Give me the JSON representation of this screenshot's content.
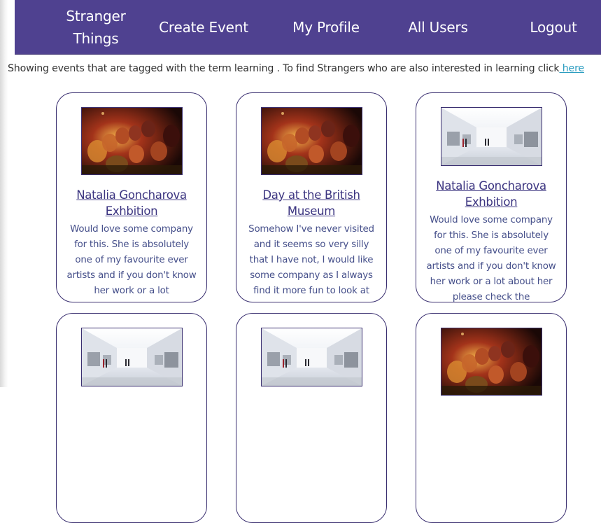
{
  "nav": {
    "brand": "Stranger Things",
    "items": [
      {
        "label": "Create Event"
      },
      {
        "label": "My Profile"
      },
      {
        "label": "All Users"
      },
      {
        "label": "Logout"
      }
    ]
  },
  "info": {
    "text": "Showing events that are tagged with the term learning . To find Strangers who are also interested in learning click",
    "link_label": " here"
  },
  "events": [
    {
      "title": "Natalia Goncharova Exhbition",
      "description": "Would love some company for this. She is absolutely one of my favourite ever artists and if you don't know her work or a lot",
      "image": "audience-photo"
    },
    {
      "title": "Day at the British Museum",
      "description": "Somehow I've never visited and it seems so very silly that I have not, I would like some company as I always find it more fun to look at",
      "image": "audience-photo"
    },
    {
      "title": "Natalia Goncharova Exhbition",
      "description": "Would love some company for this. She is absolutely one of my favourite ever artists and if you don't know her work or a lot about her please check the",
      "image": "gallery-photo"
    },
    {
      "title": "",
      "description": "",
      "image": "gallery-photo"
    },
    {
      "title": "",
      "description": "",
      "image": "gallery-photo"
    },
    {
      "title": "",
      "description": "",
      "image": "audience-photo"
    }
  ]
}
